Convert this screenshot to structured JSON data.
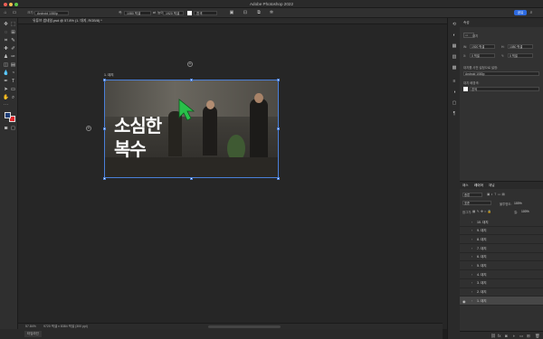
{
  "window": {
    "title": "Adobe Photoshop 2022"
  },
  "toolbar_opts": {
    "size_label": "크기:",
    "preset_value": "Android 1080p",
    "width_label": "폭:",
    "width_value": "1080 픽셀",
    "height_label": "높이:",
    "height_value": "1920 픽셀",
    "fill_label": "흰색",
    "share_label": "공유"
  },
  "document": {
    "tab_title": "유튜브 썸네일.psd @ 57.8% (1. 대지, RGB/8) *",
    "artboard_label": "1. 대지",
    "headline_line1": "소심한",
    "headline_line2": "복수"
  },
  "status": {
    "zoom": "57.84%",
    "dimensions": "9720 픽셀 x 8384 픽셀 (300 ppi)"
  },
  "bottom": {
    "timeline_label": "타임라인"
  },
  "properties": {
    "tab": "속성",
    "section": "대지",
    "w_label": "W:",
    "w_value": "1920 픽셀",
    "h_label": "H:",
    "h_value": "1080 픽셀",
    "x_label": "X:",
    "x_value": "0 픽셀",
    "y_label": "Y:",
    "y_value": "0 픽셀",
    "preset_title": "대지를 사전 설정으로 설정:",
    "preset_value": "Android 1080p",
    "bg_title": "대지 배경색:",
    "bg_value": "흰색"
  },
  "layers_panel": {
    "tabs": [
      "레이어",
      "채널",
      "패스"
    ],
    "filter_label": "종류",
    "mode": "표준",
    "opacity_label": "불투명도:",
    "opacity_value": "100%",
    "lock_label": "잠그기:",
    "fill_label": "칠:",
    "fill_value": "100%",
    "items": [
      "10. 대지",
      "9. 대지",
      "8. 대지",
      "7. 대지",
      "6. 대지",
      "5. 대지",
      "4. 대지",
      "3. 대지",
      "2. 대지",
      "1. 대지"
    ],
    "selected_index": 9
  },
  "colors": {
    "accent": "#2d6ae0",
    "selection": "#4a7fd8",
    "cursor": "#29c04a",
    "fg_swatch": "#1f3f78",
    "bg_swatch": "#e0262b"
  }
}
